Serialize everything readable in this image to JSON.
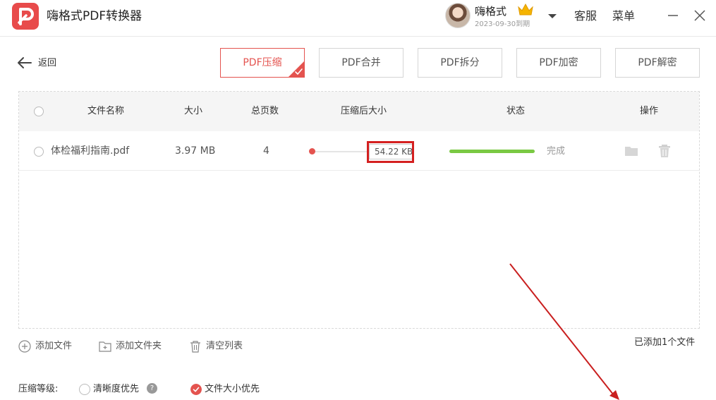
{
  "app": {
    "title": "嗨格式PDF转换器"
  },
  "user": {
    "name": "嗨格式",
    "expire": "2023-09-30到期"
  },
  "titlebar": {
    "service": "客服",
    "menu": "菜单"
  },
  "toolbar": {
    "back": "返回",
    "tabs": [
      {
        "label": "PDF压缩",
        "active": true
      },
      {
        "label": "PDF合并",
        "active": false
      },
      {
        "label": "PDF拆分",
        "active": false
      },
      {
        "label": "PDF加密",
        "active": false
      },
      {
        "label": "PDF解密",
        "active": false
      }
    ]
  },
  "table": {
    "headers": {
      "name": "文件名称",
      "size": "大小",
      "pages": "总页数",
      "compressed": "压缩后大小",
      "status": "状态",
      "actions": "操作"
    },
    "rows": [
      {
        "name": "体检福利指南.pdf",
        "size": "3.97 MB",
        "pages": "4",
        "compressed_size": "54.22 KB",
        "slider_level": 0.0,
        "progress": 1.0,
        "status": "完成"
      }
    ]
  },
  "actions": {
    "add_file": "添加文件",
    "add_folder": "添加文件夹",
    "clear": "清空列表",
    "count": "已添加1个文件"
  },
  "compression": {
    "label": "压缩等级:",
    "option_clarity": "清晰度优先",
    "option_size": "文件大小优先",
    "selected": "文件大小优先",
    "help": "?"
  },
  "colors": {
    "accent": "#e4534f",
    "success": "#7ac943",
    "annotation": "#d42020"
  },
  "icons": [
    "app-logo-icon",
    "crown-icon",
    "chevron-down-icon",
    "minimize-icon",
    "close-icon",
    "arrow-left-icon",
    "check-corner-icon",
    "folder-icon",
    "trash-icon",
    "plus-circle-icon",
    "folder-add-icon",
    "trash-clear-icon",
    "help-icon"
  ]
}
